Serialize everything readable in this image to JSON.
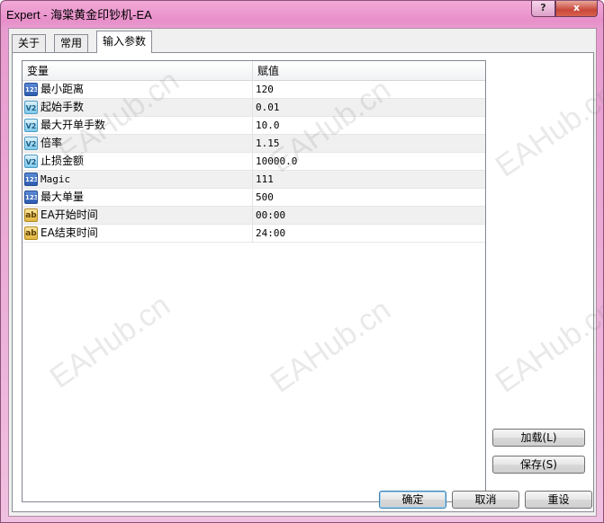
{
  "window": {
    "title": "Expert - 海棠黄金印钞机-EA",
    "help_label": "?",
    "close_label": "x"
  },
  "tabs": [
    {
      "label": "关于",
      "active": false
    },
    {
      "label": "常用",
      "active": false
    },
    {
      "label": "输入参数",
      "active": true
    }
  ],
  "grid": {
    "columns": [
      "变量",
      "赋值"
    ],
    "rows": [
      {
        "icon": "int-icon",
        "icon_text": "123",
        "name": "最小距离",
        "value": "120"
      },
      {
        "icon": "double-icon",
        "icon_text": "V2",
        "name": "起始手数",
        "value": "0.01"
      },
      {
        "icon": "double-icon",
        "icon_text": "V2",
        "name": "最大开单手数",
        "value": "10.0"
      },
      {
        "icon": "double-icon",
        "icon_text": "V2",
        "name": "倍率",
        "value": "1.15"
      },
      {
        "icon": "double-icon",
        "icon_text": "V2",
        "name": "止损金额",
        "value": "10000.0"
      },
      {
        "icon": "int-icon",
        "icon_text": "123",
        "name": "Magic",
        "value": "111"
      },
      {
        "icon": "int-icon",
        "icon_text": "123",
        "name": "最大单量",
        "value": "500"
      },
      {
        "icon": "string-icon",
        "icon_text": "ab",
        "name": "EA开始时间",
        "value": "00:00"
      },
      {
        "icon": "string-icon",
        "icon_text": "ab",
        "name": "EA结束时间",
        "value": "24:00"
      }
    ]
  },
  "side_buttons": {
    "load": "加载(L)",
    "save": "保存(S)"
  },
  "footer_buttons": {
    "ok": "确定",
    "cancel": "取消",
    "reset": "重设"
  },
  "watermark": "EAHub.cn",
  "colors": {
    "titlebar": "#e78fc9",
    "close_button": "#c9483a",
    "alt_row": "#f0f0f0"
  }
}
